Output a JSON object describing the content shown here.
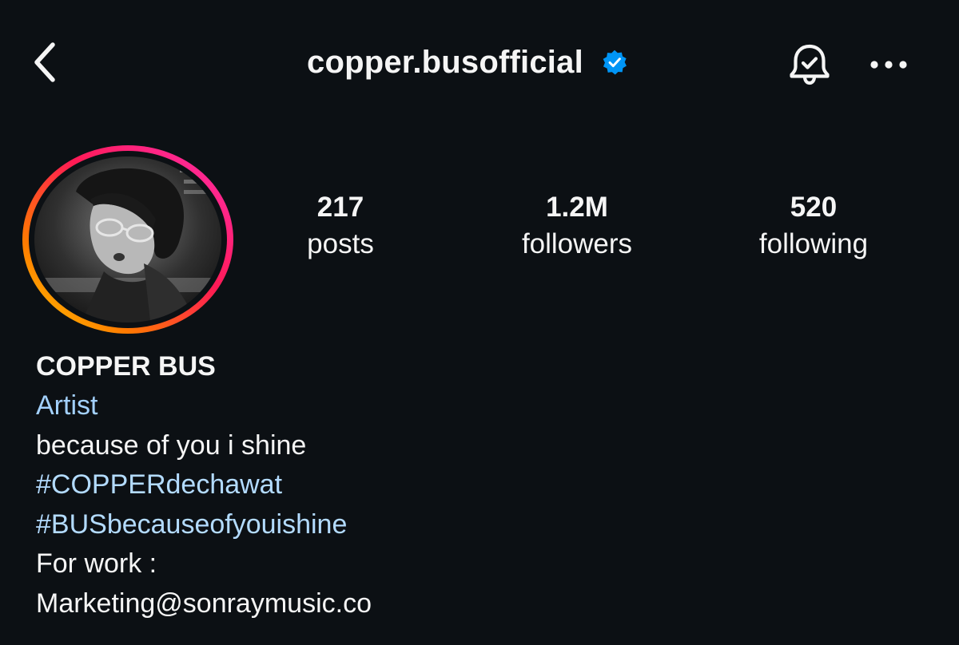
{
  "header": {
    "username": "copper.busofficial",
    "verified": true,
    "back_icon": "chevron-left-icon",
    "bell_icon": "bell-check-icon",
    "more_icon": "more-horizontal-icon"
  },
  "profile": {
    "avatar": "profile-photo",
    "story_ring_colors": [
      "#ff2fb0",
      "#ff1a55",
      "#ff7a00",
      "#ffd200"
    ],
    "verified_badge_color": "#0095f6"
  },
  "stats": {
    "posts": {
      "value": "217",
      "label": "posts"
    },
    "followers": {
      "value": "1.2M",
      "label": "followers"
    },
    "following": {
      "value": "520",
      "label": "following"
    }
  },
  "bio": {
    "display_name": "COPPER BUS",
    "category": "Artist",
    "lines": [
      "because of you i shine",
      "#COPPERdechawat",
      "#BUSbecauseofyouishine",
      "For work :",
      "Marketing@sonraymusic.co"
    ]
  },
  "colors": {
    "background": "#0c1014",
    "text": "#f5f5f5",
    "link": "#b3dbff"
  }
}
